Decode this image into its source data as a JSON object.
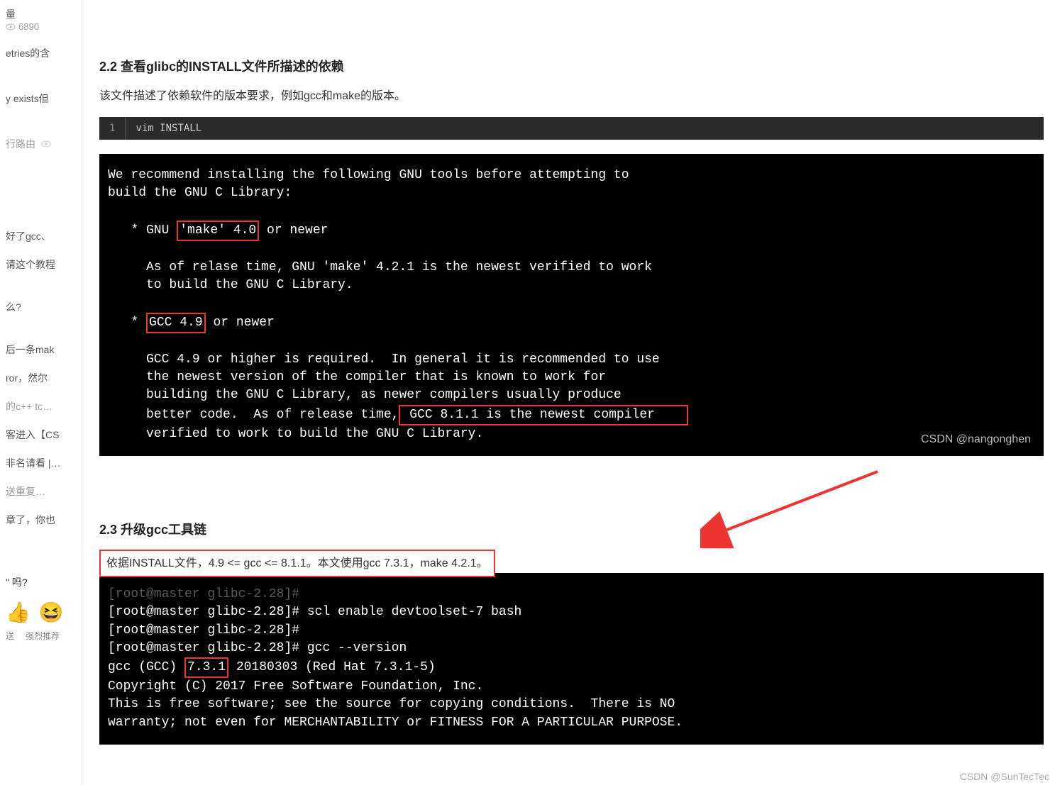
{
  "sidebar": {
    "view_count": "6890",
    "item_volume": "量",
    "item_etries": "etries的含",
    "item_exists": "y exists但",
    "item_route": "行路由",
    "item_gcc": "好了gcc、",
    "item_tutorial": "请这个教程",
    "item_me": "么?",
    "item_mak": "后一条mak",
    "item_ror": "ror，然尔",
    "item_cpp": "的c++ tc…",
    "item_cs": "客进入【CS",
    "item_rank": "非名请看 |…",
    "item_send": "送重复…",
    "item_zhang": "章了，你也",
    "prompt_ma": "\" 吗?",
    "emoji_tuijian": "送",
    "label_tuijian": "强烈推荐"
  },
  "main": {
    "h22": "2.2 查看glibc的INSTALL文件所描述的依赖",
    "p22": "该文件描述了依赖软件的版本要求，例如gcc和make的版本。",
    "code1_line": "1",
    "code1_text": "vim INSTALL",
    "term1": {
      "l1": "We recommend installing the following GNU tools before attempting to",
      "l2": "build the GNU C Library:",
      "l3a": "   * GNU ",
      "l3box": "'make' 4.0",
      "l3b": " or newer",
      "l4": "     As of relase time, GNU 'make' 4.2.1 is the newest verified to work",
      "l5": "     to build the GNU C Library.",
      "l6a": "   * ",
      "l6box": "GCC 4.9",
      "l6b": " or newer",
      "l7": "     GCC 4.9 or higher is required.  In general it is recommended to use",
      "l8": "     the newest version of the compiler that is known to work for",
      "l9": "     building the GNU C Library, as newer compilers usually produce",
      "l10a": "     better code.  As of release time,",
      "l10box": " GCC 8.1.1 is the newest compiler    ",
      "l11": "     verified to work to build the GNU C Library.",
      "watermark": "CSDN @nangonghen"
    },
    "h23": "2.3 升级gcc工具链",
    "p23": "依据INSTALL文件，4.9 <= gcc <= 8.1.1。本文使用gcc 7.3.1，make 4.2.1。",
    "term2": {
      "l0": "[root@master glibc-2.28]#",
      "l1": "[root@master glibc-2.28]# scl enable devtoolset-7 bash",
      "l2": "[root@master glibc-2.28]#",
      "l3": "[root@master glibc-2.28]# gcc --version",
      "l4a": "gcc (GCC) ",
      "l4box": "7.3.1",
      "l4b": " 20180303 (Red Hat 7.3.1-5)",
      "l5": "Copyright (C) 2017 Free Software Foundation, Inc.",
      "l6": "This is free software; see the source for copying conditions.  There is NO",
      "l7": "warranty; not even for MERCHANTABILITY or FITNESS FOR A PARTICULAR PURPOSE."
    },
    "bottom_watermark": "CSDN @SunTecTec"
  }
}
